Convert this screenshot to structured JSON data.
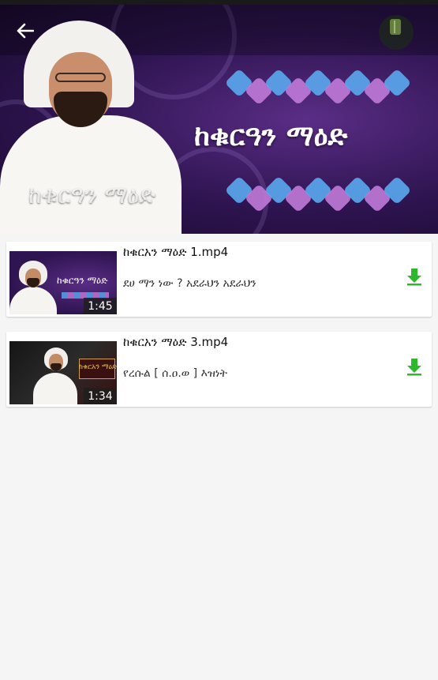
{
  "header": {
    "title_main": "ከቁርዓን ማዕድ",
    "title_overlay": "ከቁርዓን ማዕድ"
  },
  "videos": [
    {
      "title": "ከቁርአን ማዕድ 1.mp4",
      "subtitle": "ደሀ ማን ነው ? አደራህን አደራህን",
      "duration": "1:45",
      "thumb_text": "ከቁርዓን ማዕድ"
    },
    {
      "title": "ከቁርአን ማዕድ 3.mp4",
      "subtitle": "የረሱል [ ሰ.ዐ.ወ ] እዝነት",
      "duration": "1:34",
      "thumb_text": "ከቁርአን ማዕድ"
    }
  ],
  "colors": {
    "accent_green": "#2db82d",
    "header_purple": "#3a1a66",
    "diamond_blue": "#5aa8f0",
    "diamond_pink": "#c07ad8"
  },
  "icons": {
    "back": "arrow-left-icon",
    "download": "download-icon",
    "logo": "crescent-logo-icon"
  }
}
